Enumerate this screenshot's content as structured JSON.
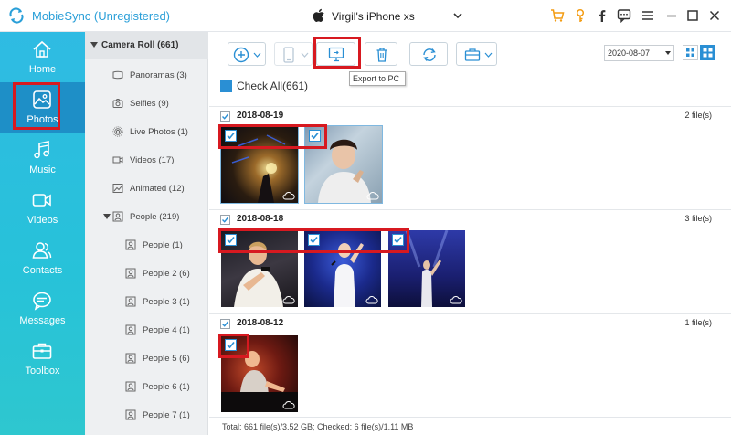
{
  "app": {
    "title": "MobieSync (Unregistered)",
    "device": "Virgil's iPhone xs"
  },
  "nav": {
    "items": [
      {
        "label": "Home",
        "icon": "home-icon"
      },
      {
        "label": "Photos",
        "icon": "photos-icon",
        "active": true
      },
      {
        "label": "Music",
        "icon": "music-icon"
      },
      {
        "label": "Videos",
        "icon": "videos-icon"
      },
      {
        "label": "Contacts",
        "icon": "contacts-icon"
      },
      {
        "label": "Messages",
        "icon": "messages-icon"
      },
      {
        "label": "Toolbox",
        "icon": "toolbox-icon"
      }
    ]
  },
  "categories": {
    "header": "Camera Roll (661)",
    "items": [
      {
        "label": "Panoramas (3)"
      },
      {
        "label": "Selfies (9)"
      },
      {
        "label": "Live Photos (1)"
      },
      {
        "label": "Videos (17)"
      },
      {
        "label": "Animated (12)"
      },
      {
        "label": "People (219)"
      },
      {
        "label": "People (1)"
      },
      {
        "label": "People 2 (6)"
      },
      {
        "label": "People 3 (1)"
      },
      {
        "label": "People 4 (1)"
      },
      {
        "label": "People 5 (6)"
      },
      {
        "label": "People 6 (1)"
      },
      {
        "label": "People 7 (1)"
      }
    ]
  },
  "toolbar": {
    "tooltip": "Export to PC",
    "date_value": "2020-08-07"
  },
  "content": {
    "check_all": "Check All(661)",
    "groups": [
      {
        "date": "2018-08-19",
        "count": "2 file(s)"
      },
      {
        "date": "2018-08-18",
        "count": "3 file(s)"
      },
      {
        "date": "2018-08-12",
        "count": "1 file(s)"
      }
    ]
  },
  "footer": {
    "status": "Total: 661 file(s)/3.52 GB; Checked: 6 file(s)/1.11 MB"
  },
  "colors": {
    "accent": "#2a8fd4",
    "nav": "#2fbbe3",
    "nav_active": "#1e8fc7",
    "highlight": "#d71920",
    "cart": "#f39c12"
  }
}
